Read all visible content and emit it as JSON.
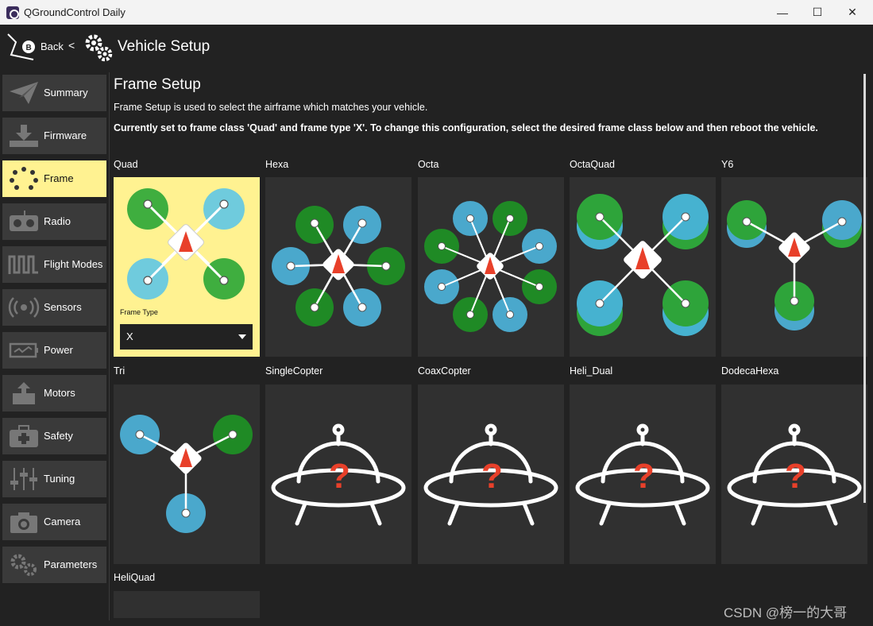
{
  "window": {
    "title": "QGroundControl Daily",
    "minimize": "—",
    "maximize": "☐",
    "close": "✕"
  },
  "toolbar": {
    "back_label": "Back",
    "separator": "<",
    "title": "Vehicle Setup"
  },
  "sidebar": {
    "items": [
      {
        "label": "Summary",
        "icon": "paper-plane-icon"
      },
      {
        "label": "Firmware",
        "icon": "download-icon"
      },
      {
        "label": "Frame",
        "icon": "frame-dots-icon",
        "active": true
      },
      {
        "label": "Radio",
        "icon": "radio-icon"
      },
      {
        "label": "Flight Modes",
        "icon": "wave-icon"
      },
      {
        "label": "Sensors",
        "icon": "sensors-icon"
      },
      {
        "label": "Power",
        "icon": "battery-icon"
      },
      {
        "label": "Motors",
        "icon": "motor-icon"
      },
      {
        "label": "Safety",
        "icon": "first-aid-icon"
      },
      {
        "label": "Tuning",
        "icon": "sliders-icon"
      },
      {
        "label": "Camera",
        "icon": "camera-icon"
      },
      {
        "label": "Parameters",
        "icon": "gears-icon"
      }
    ]
  },
  "main": {
    "title": "Frame Setup",
    "description": "Frame Setup is used to select the airframe which matches your vehicle.",
    "current": "Currently set to frame class 'Quad' and frame type 'X'. To change this configuration, select the desired frame class below and then reboot the vehicle.",
    "frame_type_label": "Frame Type",
    "frame_type_value": "X",
    "frames": [
      {
        "label": "Quad",
        "active": true
      },
      {
        "label": "Hexa"
      },
      {
        "label": "Octa"
      },
      {
        "label": "OctaQuad"
      },
      {
        "label": "Y6"
      },
      {
        "label": "Tri"
      },
      {
        "label": "SingleCopter"
      },
      {
        "label": "CoaxCopter"
      },
      {
        "label": "Heli_Dual"
      },
      {
        "label": "DodecaHexa"
      },
      {
        "label": "HeliQuad"
      }
    ]
  },
  "colors": {
    "accent": "#fff291",
    "green": "#1f8a25",
    "blue": "#4aa8cc",
    "red": "#e8402a"
  },
  "watermark": "CSDN @榜一的大哥"
}
